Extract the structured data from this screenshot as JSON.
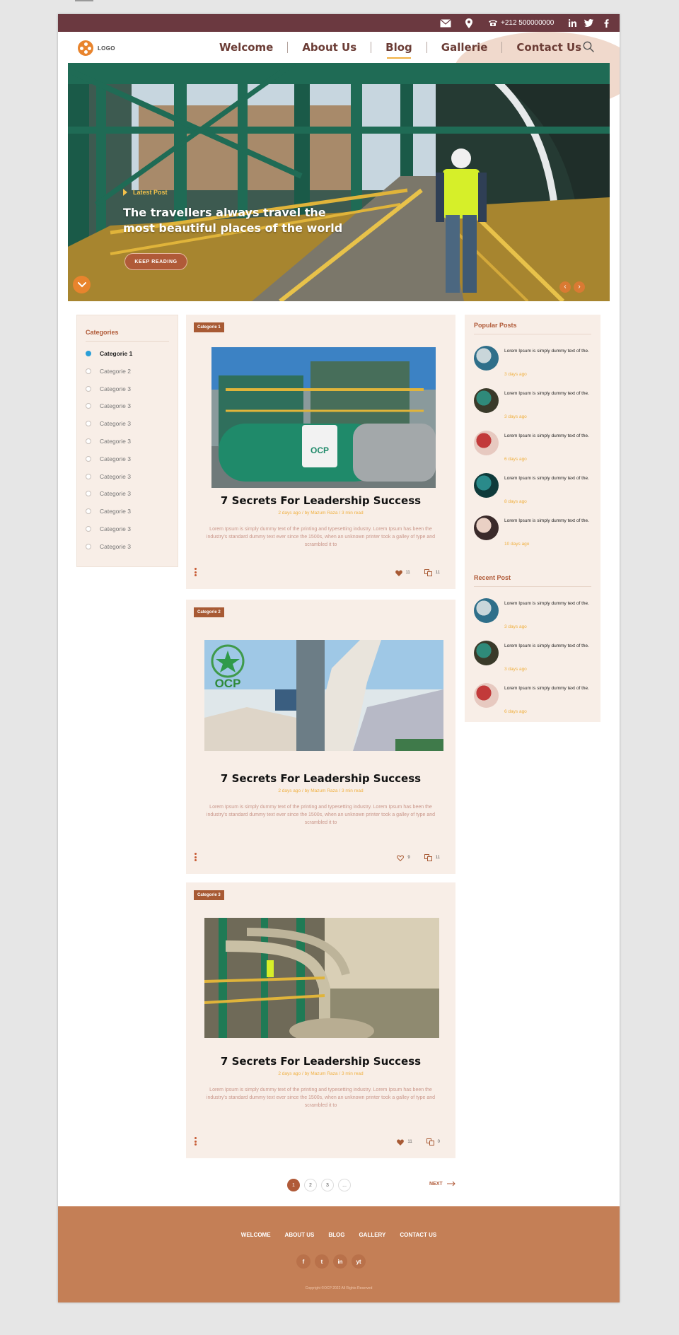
{
  "topbar": {
    "phone": "+212 500000000",
    "mail_icon": "mail-icon",
    "location_icon": "location-pin-icon",
    "phone_icon": "phone-icon",
    "social": [
      "linkedin-icon",
      "twitter-icon",
      "facebook-icon"
    ]
  },
  "nav": {
    "logo": "LOGO",
    "links": [
      "Welcome",
      "About Us",
      "Blog",
      "Gallerie",
      "Contact Us"
    ],
    "active": "Blog",
    "search_icon": "search-icon"
  },
  "hero": {
    "tag": "Latest Post",
    "title": "The travellers always travel the most beautiful places of the world",
    "button": "KEEP READING",
    "prev": "‹",
    "next": "›"
  },
  "categories": {
    "title": "Categories",
    "items": [
      "Categorie 1",
      "Categorie 2",
      "Categorie 3",
      "Categorie 3",
      "Categorie 3",
      "Categorie 3",
      "Categorie 3",
      "Categorie 3",
      "Categorie 3",
      "Categorie 3",
      "Categorie 3",
      "Categorie 3"
    ],
    "active_index": 0
  },
  "posts": [
    {
      "badge": "Categorie 1",
      "title": "7 Secrets For Leadership Success",
      "meta": "2 days ago / by Mazum Raza  /  3 min read",
      "text": "Lorem Ipsum is simply dummy text of the printing and typesetting industry. Lorem Ipsum has been the industry's standard dummy text ever since the 1500s, when an unknown printer took a galley of type and scrambled it to",
      "likes": "11",
      "shares": "11",
      "liked": true
    },
    {
      "badge": "Categorie 2",
      "title": "7 Secrets For Leadership Success",
      "meta": "2 days ago / by Mazum Raza  /  3 min read",
      "text": "Lorem Ipsum is simply dummy text of the printing and typesetting industry. Lorem Ipsum has been the industry's standard dummy text ever since the 1500s, when an unknown printer took a galley of type and scrambled it to",
      "likes": "9",
      "shares": "11",
      "liked": false
    },
    {
      "badge": "Categorie 3",
      "title": "7 Secrets For Leadership Success",
      "meta": "2 days ago / by Mazum Raza  /  3 min read",
      "text": "Lorem Ipsum is simply dummy text of the printing and typesetting industry. Lorem Ipsum has been the industry's standard dummy text ever since the 1500s, when an unknown printer took a galley of type and scrambled it to",
      "likes": "11",
      "shares": "0",
      "liked": true
    }
  ],
  "popular": {
    "title": "Popular Posts",
    "items": [
      {
        "text": "Lorem Ipsum is simply dummy text of the.",
        "ago": "3 days ago"
      },
      {
        "text": "Lorem Ipsum is simply dummy text of the.",
        "ago": "3 days ago"
      },
      {
        "text": "Lorem Ipsum is simply dummy text of the.",
        "ago": "6 days ago"
      },
      {
        "text": "Lorem Ipsum is simply dummy text of the.",
        "ago": "8 days ago"
      },
      {
        "text": "Lorem Ipsum is simply dummy text of the.",
        "ago": "10 days ago"
      }
    ]
  },
  "recent": {
    "title": "Recent Post",
    "items": [
      {
        "text": "Lorem Ipsum is simply dummy text of the.",
        "ago": "3 days ago"
      },
      {
        "text": "Lorem Ipsum is simply dummy text of the.",
        "ago": "3 days ago"
      },
      {
        "text": "Lorem Ipsum is simply dummy text of the.",
        "ago": "6 days ago"
      }
    ]
  },
  "pagination": {
    "pages": [
      "1",
      "2",
      "3",
      "..."
    ],
    "active": "1",
    "next": "NEXT"
  },
  "footer": {
    "links": [
      "WELCOME",
      "ABOUT US",
      "BLOG",
      "GALLERY",
      "CONTACT US"
    ],
    "social": [
      "f",
      "t",
      "in",
      "yt"
    ],
    "social_icons": [
      "facebook-icon",
      "twitter-icon",
      "linkedin-icon",
      "youtube-icon"
    ],
    "copyright": "Copyright ©OCP 2022 All Rights Reserved"
  },
  "colors": {
    "topbar": "#6b3940",
    "accent": "#b05a38",
    "orange": "#e8842d",
    "footer": "#c47f56",
    "panel": "#f8eee7",
    "meta": "#f0b040"
  }
}
